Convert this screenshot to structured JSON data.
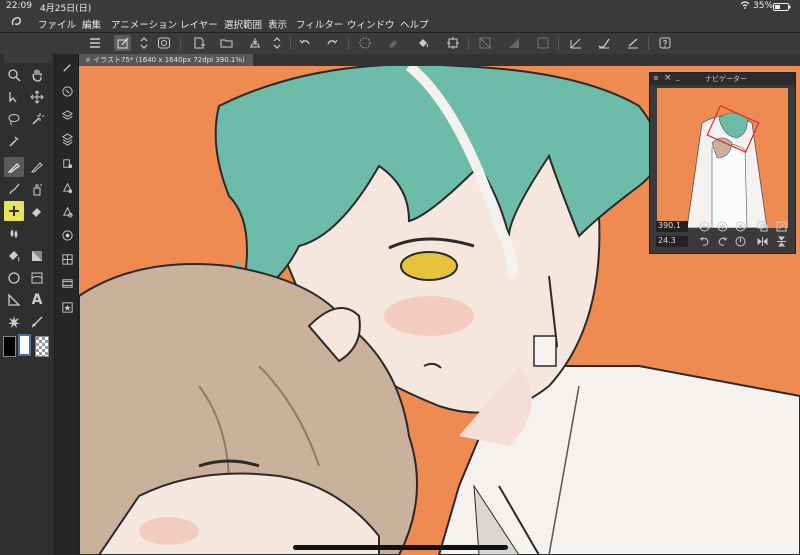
{
  "status": {
    "time": "22:09",
    "date": "4月25日(日)",
    "battery": "35%"
  },
  "menu": [
    "ファイル",
    "編集",
    "アニメーション",
    "レイヤー",
    "選択範囲",
    "表示",
    "フィルター",
    "ウィンドウ",
    "ヘルプ"
  ],
  "tab": {
    "label": "イラスト75* (1640 x 1640px 72dpi 390.1%)"
  },
  "navigator": {
    "title": "ナビゲーター",
    "zoom": "390.1",
    "angle": "24.3"
  },
  "icons": {
    "app": "logo-icon",
    "wifi": "wifi-icon",
    "battery": "battery-icon"
  },
  "colors": {
    "canvas_bg": "#ee8a52",
    "hair_green": "#6dbba9",
    "hair_brown": "#c9b19c",
    "eye": "#e8c23a"
  }
}
